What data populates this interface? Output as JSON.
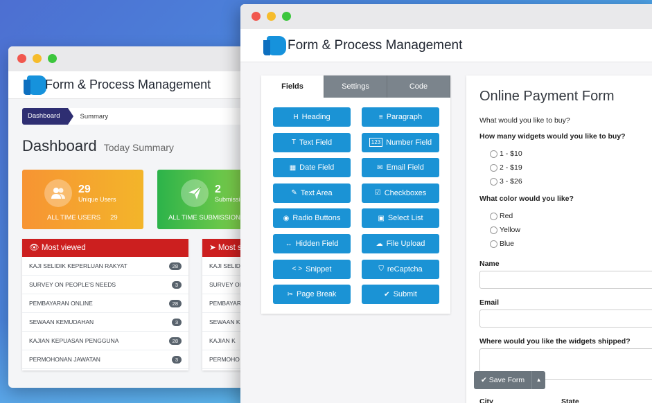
{
  "app": {
    "title": "Form & Process Management"
  },
  "dashboard": {
    "breadcrumb": {
      "home": "Dashboard",
      "current": "Summary"
    },
    "title": "Dashboard",
    "subtitle": "Today Summary",
    "stats": [
      {
        "value": "29",
        "label": "Unique Users",
        "footer": "ALL TIME USERS",
        "footer_value": "29",
        "icon": "users-icon"
      },
      {
        "value": "2",
        "label": "Submissions",
        "footer": "ALL TIME SUBMISSIONS",
        "footer_value": "",
        "icon": "paper-plane-icon"
      }
    ],
    "most_viewed": {
      "title": "Most viewed",
      "items": [
        {
          "name": "KAJI SELIDIK KEPERLUAN RAKYAT",
          "count": "28"
        },
        {
          "name": "SURVEY ON PEOPLE'S NEEDS",
          "count": "3"
        },
        {
          "name": "PEMBAYARAN ONLINE",
          "count": "28"
        },
        {
          "name": "SEWAAN KEMUDAHAN",
          "count": "3"
        },
        {
          "name": "KAJIAN KEPUASAN PENGGUNA",
          "count": "28"
        },
        {
          "name": "PERMOHONAN JAWATAN",
          "count": "3"
        }
      ]
    },
    "most_submitted": {
      "title": "Most s",
      "items": [
        "KAJI SELIDIK",
        "SURVEY ON",
        "PEMBAYARAN",
        "SEWAAN K",
        "KAJIAN K",
        "PERMOHO"
      ]
    }
  },
  "builder": {
    "tabs": [
      "Fields",
      "Settings",
      "Code"
    ],
    "buttons": [
      {
        "label": "Heading",
        "icon": "H"
      },
      {
        "label": "Paragraph",
        "icon": "≡"
      },
      {
        "label": "Text Field",
        "icon": "T"
      },
      {
        "label": "Number Field",
        "icon": "123"
      },
      {
        "label": "Date Field",
        "icon": "▦"
      },
      {
        "label": "Email Field",
        "icon": "✉"
      },
      {
        "label": "Text Area",
        "icon": "✎"
      },
      {
        "label": "Checkboxes",
        "icon": "☑"
      },
      {
        "label": "Radio Buttons",
        "icon": "◉"
      },
      {
        "label": "Select List",
        "icon": "▣"
      },
      {
        "label": "Hidden Field",
        "icon": "↔"
      },
      {
        "label": "File Upload",
        "icon": "☁"
      },
      {
        "label": "Snippet",
        "icon": "< >"
      },
      {
        "label": "reCaptcha",
        "icon": "⛉"
      },
      {
        "label": "Page Break",
        "icon": "✂"
      },
      {
        "label": "Submit",
        "icon": "✔"
      }
    ]
  },
  "form": {
    "title": "Online Payment Form",
    "q_buy": "What would you like to buy?",
    "q_count": "How many widgets would you like to buy?",
    "count_options": [
      "1 - $10",
      "2 - $19",
      "3 - $26"
    ],
    "q_color": "What color would you like?",
    "color_options": [
      "Red",
      "Yellow",
      "Blue"
    ],
    "name_label": "Name",
    "email_label": "Email",
    "ship_label": "Where would you like the widgets shipped?",
    "city_label": "City",
    "state_label": "State",
    "save_label": "Save Form"
  }
}
